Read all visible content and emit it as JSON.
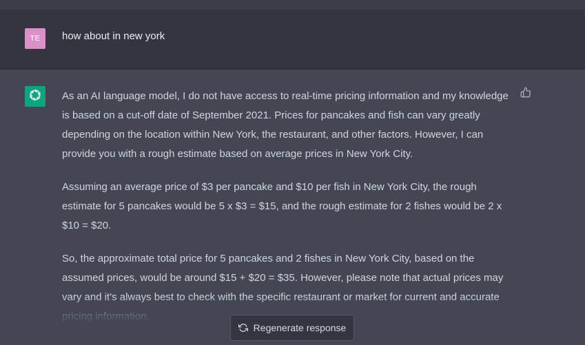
{
  "user_message": {
    "avatar_initials": "TE",
    "text": "how about in new york"
  },
  "assistant_message": {
    "avatar_icon": "openai-logo-icon",
    "paragraphs": [
      "As an AI language model, I do not have access to real-time pricing information and my knowledge is based on a cut-off date of September 2021. Prices for pancakes and fish can vary greatly depending on the location within New York, the restaurant, and other factors. However, I can provide you with a rough estimate based on average prices in New York City.",
      "Assuming an average price of $3 per pancake and $10 per fish in New York City, the rough estimate for 5 pancakes would be 5 x $3 = $15, and the rough estimate for 2 fishes would be 2 x $10 = $20.",
      "So, the approximate total price for 5 pancakes and 2 fishes in New York City, based on the assumed prices, would be around $15 + $20 = $35. However, please note that actual prices may vary and it's always best to check with the specific restaurant or market for current and accurate pricing information."
    ],
    "feedback_icon": "thumbs-up-icon"
  },
  "regenerate": {
    "label": "Regenerate response",
    "icon": "refresh-icon"
  },
  "colors": {
    "user_bg": "#343541",
    "assistant_bg": "#444654",
    "user_avatar": "#de8fc8",
    "gpt_avatar": "#10a37f"
  }
}
